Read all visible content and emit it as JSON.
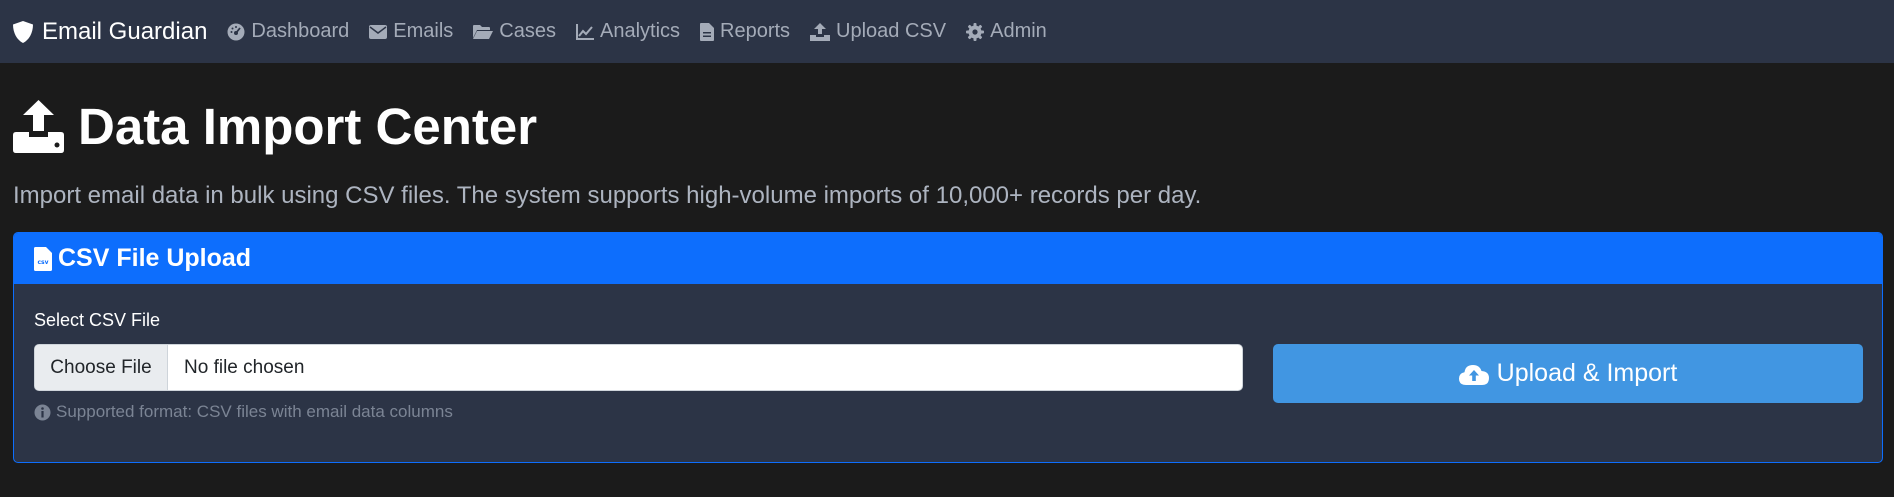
{
  "nav": {
    "brand": "Email Guardian",
    "items": [
      {
        "label": "Dashboard",
        "icon": "dashboard-icon"
      },
      {
        "label": "Emails",
        "icon": "envelope-icon"
      },
      {
        "label": "Cases",
        "icon": "folder-icon"
      },
      {
        "label": "Analytics",
        "icon": "chart-line-icon"
      },
      {
        "label": "Reports",
        "icon": "file-icon"
      },
      {
        "label": "Upload CSV",
        "icon": "upload-icon"
      },
      {
        "label": "Admin",
        "icon": "gear-icon"
      }
    ]
  },
  "page": {
    "title": "Data Import Center",
    "lead": "Import email data in bulk using CSV files. The system supports high-volume imports of 10,000+ records per day."
  },
  "upload_card": {
    "header": "CSV File Upload",
    "field_label": "Select CSV File",
    "choose_button": "Choose File",
    "file_status": "No file chosen",
    "help_text": "Supported format: CSV files with email data columns",
    "submit_label": "Upload & Import"
  },
  "colors": {
    "navbar": "#2c3446",
    "background": "#1b1b1b",
    "primary": "#0d6efd",
    "button": "#4196e2",
    "nav_text": "#a4abb8"
  }
}
